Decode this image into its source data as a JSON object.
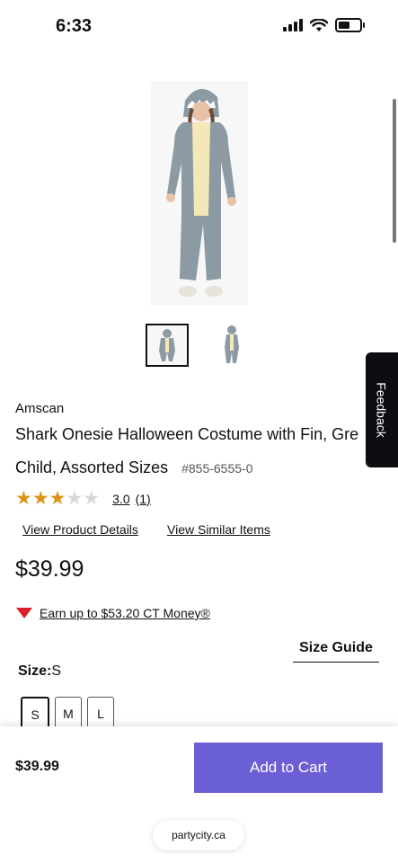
{
  "status_bar": {
    "time": "6:33",
    "icons": [
      "cellular-signal-icon",
      "wifi-icon",
      "battery-icon"
    ]
  },
  "feedback": {
    "label": "Feedback"
  },
  "product": {
    "brand": "Amscan",
    "title_line1": "Shark Onesie Halloween Costume with Fin, Gre",
    "title_line2": "Child, Assorted Sizes",
    "sku": "#855-6555-0",
    "rating": {
      "stars": 3,
      "max": 5,
      "value": "3.0",
      "count": "(1)"
    },
    "links": {
      "details": "View Product Details",
      "similar": "View Similar Items"
    },
    "price": "$39.99",
    "ct_money": "Earn up to $53.20 CT Money®",
    "size_guide": "Size Guide",
    "size_label": "Size:",
    "size_selected": "S",
    "sizes": [
      "S",
      "M",
      "L"
    ]
  },
  "bottom_bar": {
    "price": "$39.99",
    "add_to_cart": "Add to Cart"
  },
  "browser": {
    "domain": "partycity.ca"
  },
  "colors": {
    "accent": "#6b5fd6",
    "star": "#d99414",
    "ct_red": "#d8212a",
    "feedback_bg": "#0d0d12"
  }
}
